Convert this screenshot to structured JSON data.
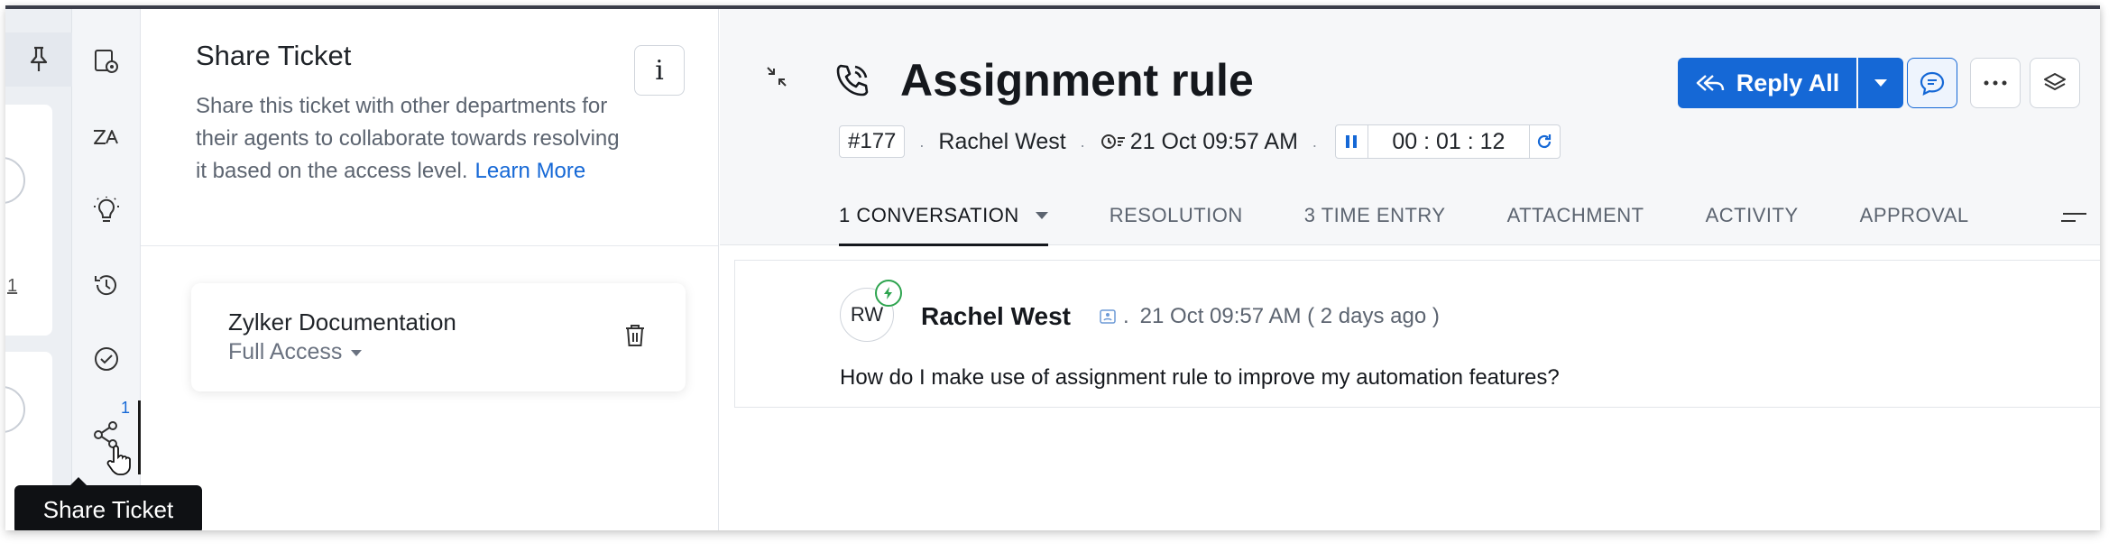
{
  "strip": {
    "item_number": "1"
  },
  "rail": {
    "share_badge": "1",
    "icons": [
      "settings-icon",
      "translate-icon",
      "bulb-icon",
      "history-icon",
      "check-circle-icon",
      "share-icon"
    ]
  },
  "tooltip": {
    "label": "Share Ticket"
  },
  "share_panel": {
    "title": "Share Ticket",
    "info_label": "i",
    "description": "Share this ticket with other departments for their agents to collaborate towards resolving it based on the access level.",
    "learn_more": "Learn More",
    "department": {
      "name": "Zylker Documentation",
      "access": "Full Access"
    }
  },
  "ticket": {
    "title": "Assignment rule",
    "id": "#177",
    "contact": "Rachel West",
    "due_date": "21 Oct 09:57 AM",
    "timer": "00 : 01 : 12"
  },
  "actions": {
    "reply_all": "Reply All"
  },
  "tabs": [
    {
      "label": "1 CONVERSATION",
      "active": true
    },
    {
      "label": "RESOLUTION"
    },
    {
      "label": "3 TIME ENTRY"
    },
    {
      "label": "ATTACHMENT"
    },
    {
      "label": "ACTIVITY"
    },
    {
      "label": "APPROVAL"
    }
  ],
  "conversation": {
    "initials": "RW",
    "author": "Rachel West",
    "time": "21 Oct 09:57 AM ( 2 days ago )",
    "message": "How do I make use of assignment rule to improve my automation features?"
  },
  "colors": {
    "accent": "#1568d6",
    "tooltip_bg": "#0f1114",
    "agent_badge": "#2ea44f"
  }
}
